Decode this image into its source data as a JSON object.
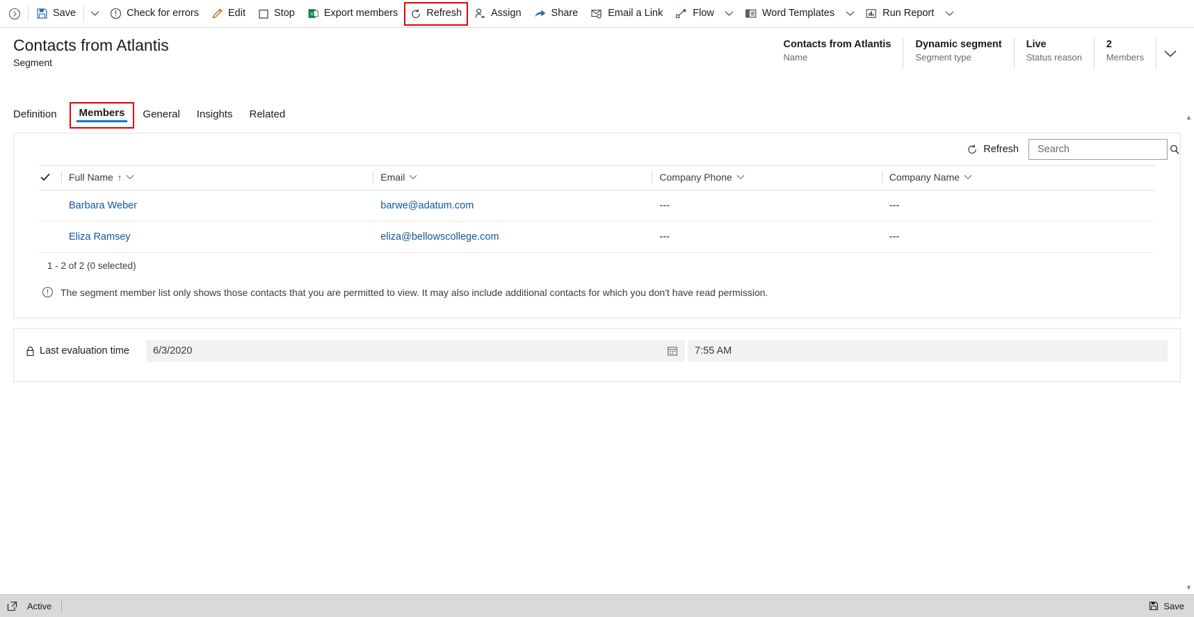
{
  "commandbar": {
    "back_label": "Back",
    "items": [
      {
        "id": "save",
        "label": "Save",
        "icon": "save-icon",
        "caret": false
      },
      {
        "id": "save-menu",
        "label": "",
        "icon": "chevron-down-icon",
        "caret": true
      },
      {
        "id": "check-for-errors",
        "label": "Check for errors",
        "icon": "error-circle-icon",
        "caret": false
      },
      {
        "id": "edit",
        "label": "Edit",
        "icon": "pencil-icon",
        "caret": false
      },
      {
        "id": "stop",
        "label": "Stop",
        "icon": "stop-square-icon",
        "caret": false
      },
      {
        "id": "export-members",
        "label": "Export members",
        "icon": "excel-icon",
        "caret": false
      },
      {
        "id": "refresh",
        "label": "Refresh",
        "icon": "refresh-icon",
        "caret": false,
        "highlighted": true
      },
      {
        "id": "assign",
        "label": "Assign",
        "icon": "assign-person-icon",
        "caret": false
      },
      {
        "id": "share",
        "label": "Share",
        "icon": "share-icon",
        "caret": false
      },
      {
        "id": "email-a-link",
        "label": "Email a Link",
        "icon": "email-link-icon",
        "caret": false
      },
      {
        "id": "flow",
        "label": "Flow",
        "icon": "flow-icon",
        "caret": true
      },
      {
        "id": "word-templates",
        "label": "Word Templates",
        "icon": "word-template-icon",
        "caret": true
      },
      {
        "id": "run-report",
        "label": "Run Report",
        "icon": "run-report-icon",
        "caret": true
      }
    ]
  },
  "header": {
    "title": "Contacts from Atlantis",
    "subtitle": "Segment",
    "fields": [
      {
        "value": "Contacts from Atlantis",
        "key": "Name"
      },
      {
        "value": "Dynamic segment",
        "key": "Segment type"
      },
      {
        "value": "Live",
        "key": "Status reason"
      },
      {
        "value": "2",
        "key": "Members"
      }
    ],
    "expand_icon": "chevron-down-icon"
  },
  "tabs": [
    {
      "label": "Definition",
      "selected": false,
      "highlighted": false
    },
    {
      "label": "Members",
      "selected": true,
      "highlighted": true
    },
    {
      "label": "General",
      "selected": false,
      "highlighted": false
    },
    {
      "label": "Insights",
      "selected": false,
      "highlighted": false
    },
    {
      "label": "Related",
      "selected": false,
      "highlighted": false
    }
  ],
  "grid": {
    "refresh_label": "Refresh",
    "refresh_icon": "refresh-icon",
    "search_placeholder": "Search",
    "search_value": "",
    "search_icon": "magnifier-icon",
    "select_all_icon": "checkmark-icon",
    "columns": [
      {
        "label": "Full Name",
        "sorted": true,
        "sort_arrow": "↑"
      },
      {
        "label": "Email",
        "sorted": false,
        "sort_arrow": ""
      },
      {
        "label": "Company Phone",
        "sorted": false,
        "sort_arrow": ""
      },
      {
        "label": "Company Name",
        "sorted": false,
        "sort_arrow": ""
      }
    ],
    "rows": [
      {
        "full_name": "Barbara Weber",
        "email": "barwe@adatum.com",
        "company_phone": "---",
        "company_name": "---"
      },
      {
        "full_name": "Eliza Ramsey",
        "email": "eliza@bellowscollege.com",
        "company_phone": "---",
        "company_name": "---"
      }
    ],
    "count_text": "1 - 2 of 2 (0 selected)",
    "note_icon": "info-circle-icon",
    "note_text": "The segment member list only shows those contacts that you are permitted to view. It may also include additional contacts for which you don't have read permission."
  },
  "evaluation": {
    "lock_icon": "lock-icon",
    "label": "Last evaluation time",
    "date_value": "6/3/2020",
    "calendar_icon": "calendar-icon",
    "time_value": "7:55 AM"
  },
  "scrollbar": {
    "up_icon": "triangle-up-icon",
    "down_icon": "triangle-down-icon"
  },
  "statusbar": {
    "popout_icon": "popout-icon",
    "state_label": "Active",
    "save_label": "Save",
    "save_icon": "save-icon"
  },
  "colors": {
    "accent": "#0078d4",
    "highlight": "#e50000",
    "link": "#13559e",
    "excel_green": "#107c41",
    "statusbar_bg": "#d9d9d9"
  }
}
